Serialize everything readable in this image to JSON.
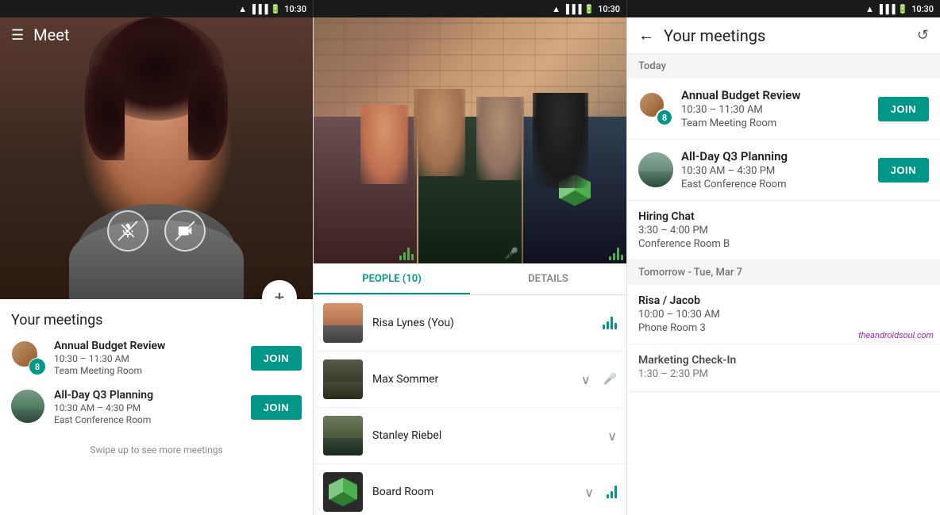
{
  "statusBar": {
    "time": "10:30",
    "icons": [
      "wifi",
      "signal",
      "battery"
    ]
  },
  "leftPanel": {
    "appTitle": "Meet",
    "meetingsTitle": "Your meetings",
    "meetings": [
      {
        "name": "Annual Budget Review",
        "time": "10:30 – 11:30 AM",
        "room": "Team Meeting Room",
        "joinLabel": "JOIN",
        "avatarCount": "8"
      },
      {
        "name": "All-Day Q3 Planning",
        "time": "10:30 AM – 4:30 PM",
        "room": "East Conference Room",
        "joinLabel": "JOIN"
      }
    ],
    "swipeHint": "Swipe up to see more meetings"
  },
  "middlePanel": {
    "tabs": [
      {
        "label": "PEOPLE (10)",
        "active": true
      },
      {
        "label": "DETAILS",
        "active": false
      }
    ],
    "people": [
      {
        "name": "Risa Lynes (You)",
        "hasSoundBars": true,
        "hasMute": false
      },
      {
        "name": "Max Sommer",
        "hasSoundBars": false,
        "hasMute": true
      },
      {
        "name": "Stanley Riebel",
        "hasSoundBars": true,
        "hasMute": false
      },
      {
        "name": "Board Room",
        "hasSoundBars": true,
        "hasMute": false
      }
    ]
  },
  "rightPanel": {
    "title": "Your meetings",
    "backLabel": "←",
    "refreshLabel": "↺",
    "sections": [
      {
        "header": "Today",
        "meetings": [
          {
            "name": "Annual Budget Review",
            "time": "10:30 – 11:30 AM",
            "room": "Team Meeting Room",
            "joinLabel": "JOIN",
            "hasJoin": true
          },
          {
            "name": "All-Day Q3 Planning",
            "time": "10:30 AM – 4:30 PM",
            "room": "East Conference Room",
            "joinLabel": "JOIN",
            "hasJoin": true
          },
          {
            "name": "Hiring Chat",
            "time": "3:30 – 4:00 PM",
            "room": "Conference Room B",
            "hasJoin": false
          }
        ]
      },
      {
        "header": "Tomorrow - Tue, Mar 7",
        "meetings": [
          {
            "name": "Risa / Jacob",
            "time": "10:00 – 10:30 AM",
            "room": "Phone Room 3",
            "hasJoin": false
          },
          {
            "name": "Marketing Check-In",
            "time": "1:30 – 2:30 PM",
            "room": "",
            "hasJoin": false
          }
        ]
      }
    ],
    "watermark": "theandroidsoul.com"
  }
}
